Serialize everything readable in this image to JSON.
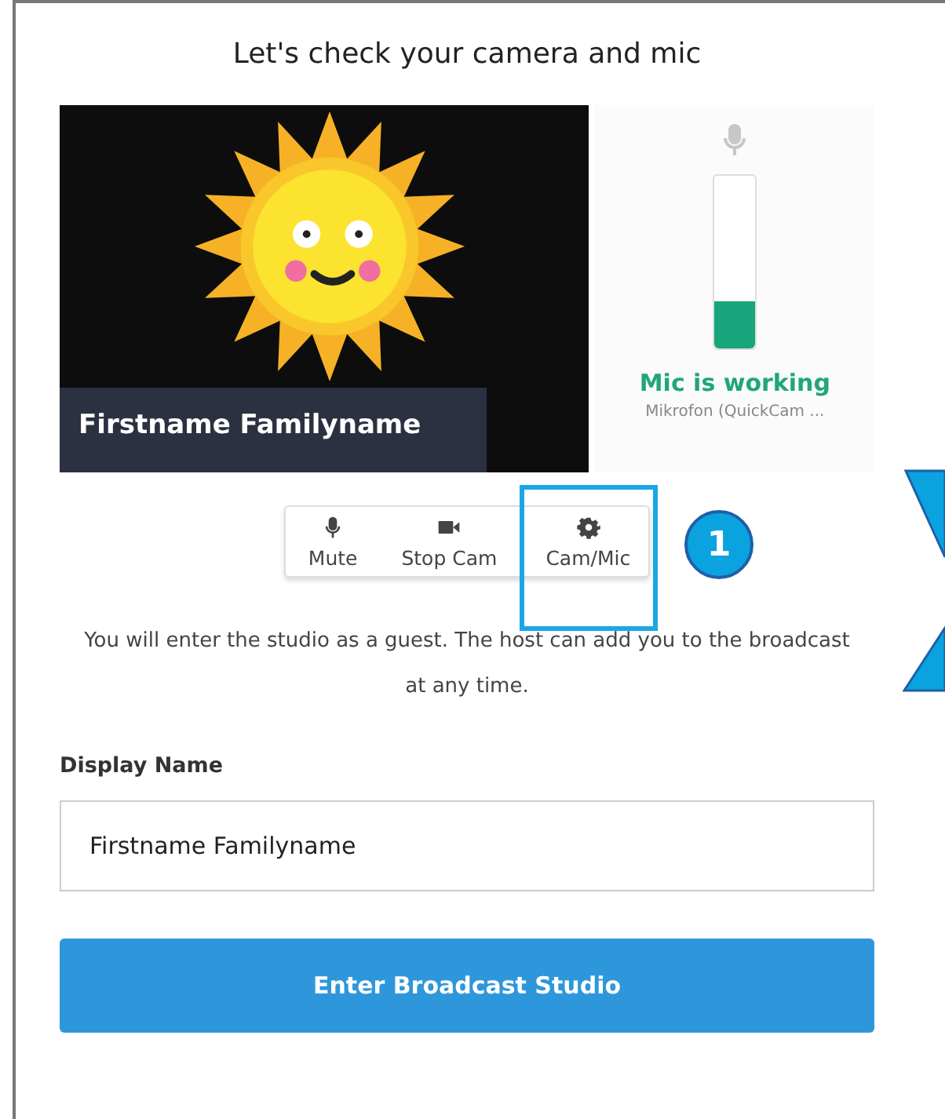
{
  "title": "Let's check your camera and mic",
  "preview": {
    "name": "Firstname Familyname"
  },
  "mic": {
    "status": "Mic is working",
    "device": "Mikrofon (QuickCam ...",
    "level": 0.27
  },
  "controls": [
    {
      "label": "Mute",
      "kind": "mic",
      "highlighted": false
    },
    {
      "label": "Stop Cam",
      "kind": "camera",
      "highlighted": false
    },
    {
      "label": "Cam/Mic",
      "kind": "settings",
      "highlighted": true
    }
  ],
  "callout": {
    "number": "1"
  },
  "note": "You will enter the studio as a guest. The host can add you to the broadcast at any time.",
  "display_name": {
    "label": "Display Name",
    "value": "Firstname Familyname"
  },
  "submit": "Enter Broadcast Studio"
}
